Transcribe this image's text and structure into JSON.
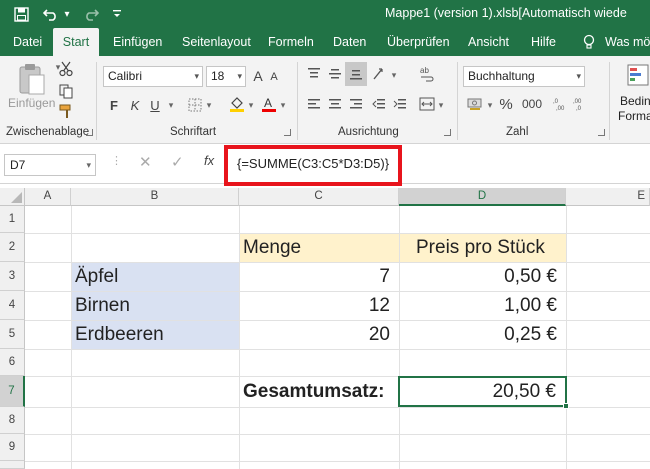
{
  "window": {
    "title": "Mappe1 (version 1).xlsb[Automatisch wiede"
  },
  "qat": {
    "save_icon": "save-icon",
    "undo_icon": "undo-icon",
    "undo_caret": "▾",
    "redo_icon": "redo-icon",
    "customize_icon": "customize-icon"
  },
  "tabs": [
    {
      "label": "Datei"
    },
    {
      "label": "Start"
    },
    {
      "label": "Einfügen"
    },
    {
      "label": "Seitenlayout"
    },
    {
      "label": "Formeln"
    },
    {
      "label": "Daten"
    },
    {
      "label": "Überprüfen"
    },
    {
      "label": "Ansicht"
    },
    {
      "label": "Hilfe"
    },
    {
      "label": "Was möc"
    }
  ],
  "ribbon": {
    "clipboard": {
      "label": "Zwischenablage",
      "paste_label": "Einfügen"
    },
    "font": {
      "label": "Schriftart",
      "family": "Calibri",
      "size": "18",
      "grow": "A",
      "shrink": "A",
      "bold": "F",
      "italic": "K",
      "underline": "U"
    },
    "alignment": {
      "label": "Ausrichtung"
    },
    "number": {
      "label": "Zahl",
      "format": "Buchhaltung",
      "percent": "%",
      "thousands": "000"
    },
    "styles": {
      "conditional_line1": "Beding",
      "conditional_line2": "Formatier"
    }
  },
  "formula_bar": {
    "name_box": "D7",
    "cancel": "✕",
    "enter": "✓",
    "fx": "fx",
    "formula": "{=SUMME(C3:C5*D3:D5)}"
  },
  "grid": {
    "columns": [
      "A",
      "B",
      "C",
      "D",
      "E"
    ],
    "rows": [
      "1",
      "2",
      "3",
      "4",
      "5",
      "6",
      "7",
      "8",
      "9"
    ],
    "cells": {
      "C2": "Menge",
      "D2": "Preis pro Stück",
      "B3": "Äpfel",
      "C3": "7",
      "D3": "0,50 €",
      "B4": "Birnen",
      "C4": "12",
      "D4": "1,00 €",
      "B5": "Erdbeeren",
      "C5": "20",
      "D5": "0,25 €",
      "C7": "Gesamtumsatz:",
      "D7": "20,50 €"
    }
  },
  "colors": {
    "accent": "#217346",
    "highlight": "#e8141c",
    "fill_blue": "#d9e1f2",
    "fill_yellow": "#fff2cc"
  }
}
